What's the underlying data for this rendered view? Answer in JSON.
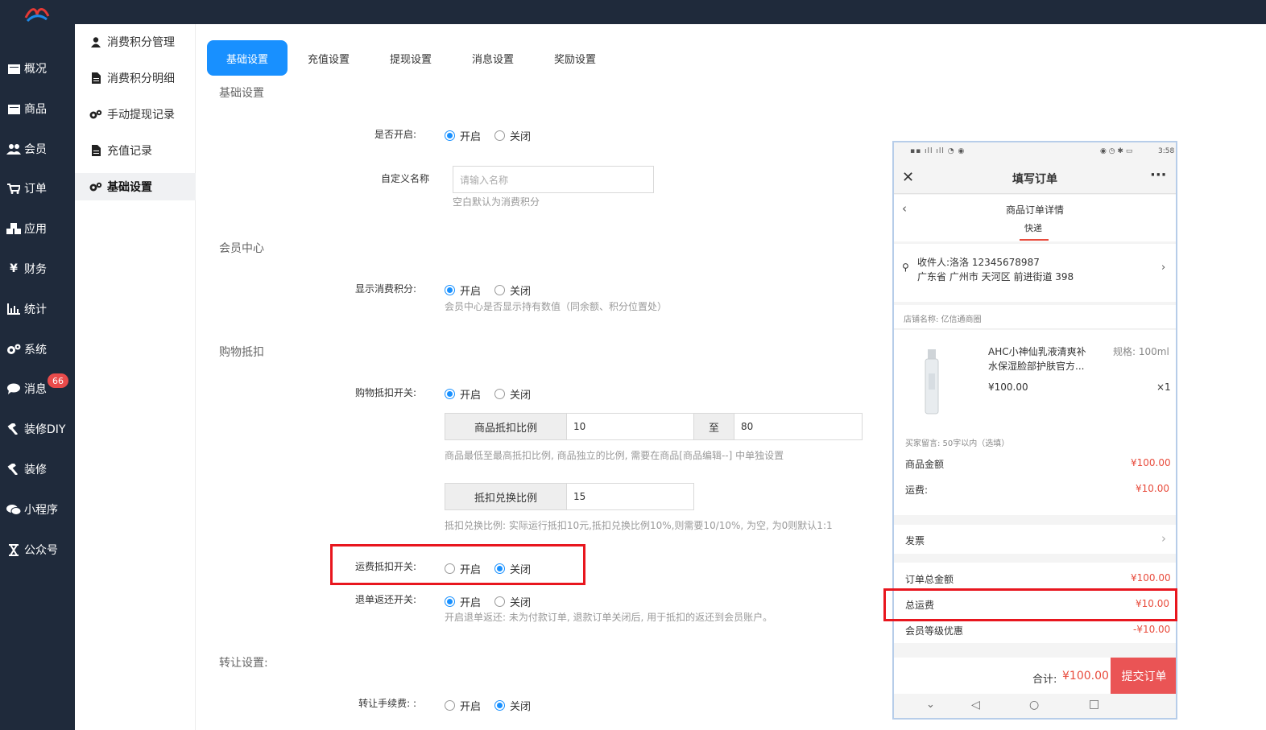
{
  "nav": {
    "items": [
      {
        "label": "概况",
        "icon": "dashboard-icon"
      },
      {
        "label": "商品",
        "icon": "goods-icon"
      },
      {
        "label": "会员",
        "icon": "users-icon"
      },
      {
        "label": "订单",
        "icon": "cart-icon"
      },
      {
        "label": "应用",
        "icon": "apps-icon"
      },
      {
        "label": "财务",
        "icon": "yen-icon"
      },
      {
        "label": "统计",
        "icon": "chart-icon"
      },
      {
        "label": "系统",
        "icon": "gear-icon"
      },
      {
        "label": "消息",
        "icon": "chat-icon",
        "badge": "66"
      },
      {
        "label": "装修DIY",
        "icon": "hammer-icon"
      },
      {
        "label": "装修",
        "icon": "hammer-icon"
      },
      {
        "label": "小程序",
        "icon": "wechat-icon"
      },
      {
        "label": "公众号",
        "icon": "hourglass-icon"
      }
    ]
  },
  "subnav": {
    "items": [
      {
        "label": "消费积分管理",
        "icon": "user-icon"
      },
      {
        "label": "消费积分明细",
        "icon": "file-icon"
      },
      {
        "label": "手动提现记录",
        "icon": "gears-icon"
      },
      {
        "label": "充值记录",
        "icon": "file-icon"
      },
      {
        "label": "基础设置",
        "icon": "gears-icon",
        "active": true
      }
    ]
  },
  "tabs": [
    "基础设置",
    "充值设置",
    "提现设置",
    "消息设置",
    "奖励设置"
  ],
  "form": {
    "section_basic": "基础设置",
    "enable_label": "是否开启:",
    "on": "开启",
    "off": "关闭",
    "name_label": "自定义名称",
    "name_placeholder": "请输入名称",
    "name_help": "空白默认为消费积分",
    "section_member": "会员中心",
    "show_label": "显示消费积分:",
    "show_help": "会员中心是否显示持有数值（同余额、积分位置处）",
    "section_deduct": "购物抵扣",
    "deduct_switch_label": "购物抵扣开关:",
    "ratio_addon": "商品抵扣比例",
    "ratio_min": "10",
    "ratio_to": "至",
    "ratio_max": "80",
    "ratio_help": "商品最低至最高抵扣比例, 商品独立的比例, 需要在商品[商品编辑--] 中单独设置",
    "exchange_addon": "抵扣兑换比例",
    "exchange_value": "15",
    "exchange_help": "抵扣兑换比例: 实际运行抵扣10元,抵扣兑换比例10%,则需要10/10%, 为空, 为0则默认1:1",
    "freight_label": "运费抵扣开关:",
    "refund_label": "退单返还开关:",
    "refund_help": "开启退单返还: 未为付款订单, 退款订单关闭后, 用于抵扣的返还到会员账户。",
    "section_transfer": "转让设置:",
    "transfer_label": "转让手续费: :"
  },
  "phone": {
    "status_time": "3:58",
    "title": "填写订单",
    "subtitle": "商品订单详情",
    "tab_cut": "快递",
    "receiver": "收件人:洛洛 12345678987",
    "address": "广东省 广州市 天河区 前进街道 398",
    "shop_label": "店铺名称:  亿信通商圈",
    "product_name_1": "AHC小神仙乳液清爽补",
    "product_name_2": "水保湿脸部护肤官方...",
    "spec": "规格: 100ml",
    "price": "¥100.00",
    "qty": "×1",
    "message": "买家留言:  50字以内（选填）",
    "goods_amount_label": "商品金额",
    "goods_amount": "¥100.00",
    "freight_label": "运费:",
    "freight": "¥10.00",
    "invoice": "发票",
    "order_total_label": "订单总金额",
    "order_total": "¥100.00",
    "total_freight_label": "总运费",
    "total_freight": "¥10.00",
    "member_discount_label": "会员等级优惠",
    "member_discount": "-¥10.00",
    "sum_label": "合计:",
    "sum": "¥100.00",
    "submit": "提交订单"
  },
  "colors": {
    "primary": "#1890ff",
    "nav_bg": "#1f2a3b",
    "highlight": "#e8161e",
    "price": "#e84c3d"
  }
}
